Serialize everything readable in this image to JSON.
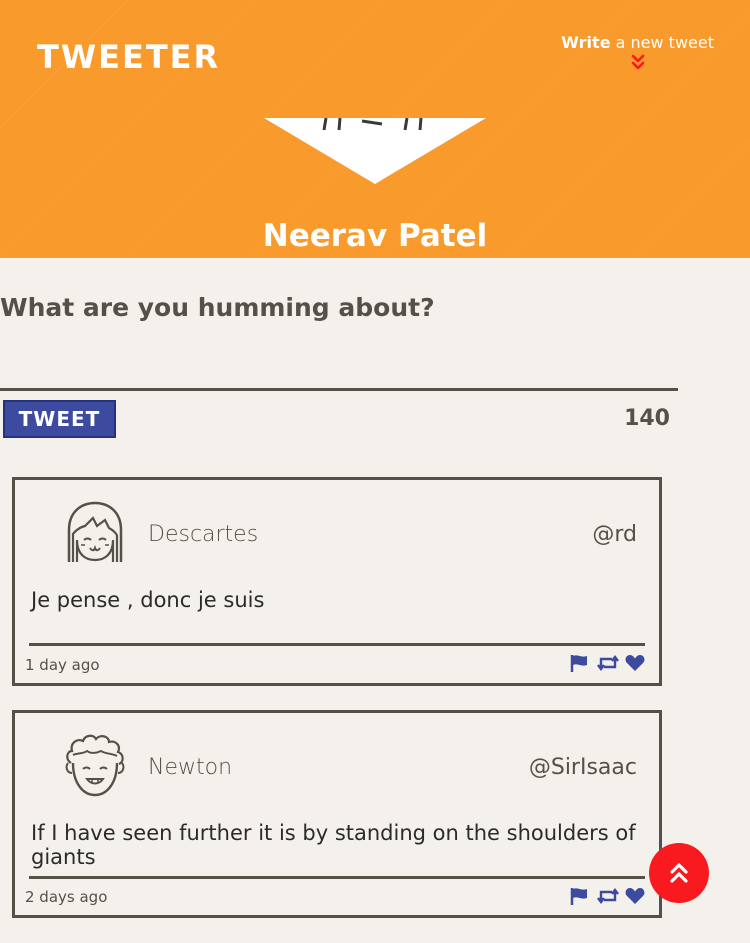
{
  "nav": {
    "logo": "TWEETER",
    "compose_bold": "Write",
    "compose_rest": " a new tweet",
    "chevron_icon": "double-chevron-down-icon"
  },
  "profile": {
    "name": "Neerav Patel",
    "avatar_icon": "profile-avatar-icon"
  },
  "compose": {
    "prompt": "What are you humming about?",
    "placeholder": "",
    "button_label": "TWEET",
    "counter": "140"
  },
  "tweets": [
    {
      "avatar_icon": "girl-avatar-icon",
      "name": "Descartes",
      "handle": "@rd",
      "text": "Je pense , donc je suis",
      "time": "1 day ago"
    },
    {
      "avatar_icon": "curly-hair-avatar-icon",
      "name": "Newton",
      "handle": "@SirIsaac",
      "text": "If I have seen further it is by standing on the shoulders of giants",
      "time": "2 days ago"
    }
  ],
  "actions": [
    "flag-icon",
    "retweet-icon",
    "heart-icon"
  ],
  "colors": {
    "header": "#f99a2c",
    "background": "#f4f1ec",
    "button": "#3c4aa0",
    "action_icons": "#3c4aa0",
    "scroll_button": "#f81a1e",
    "chevron": "#f81a1e"
  }
}
